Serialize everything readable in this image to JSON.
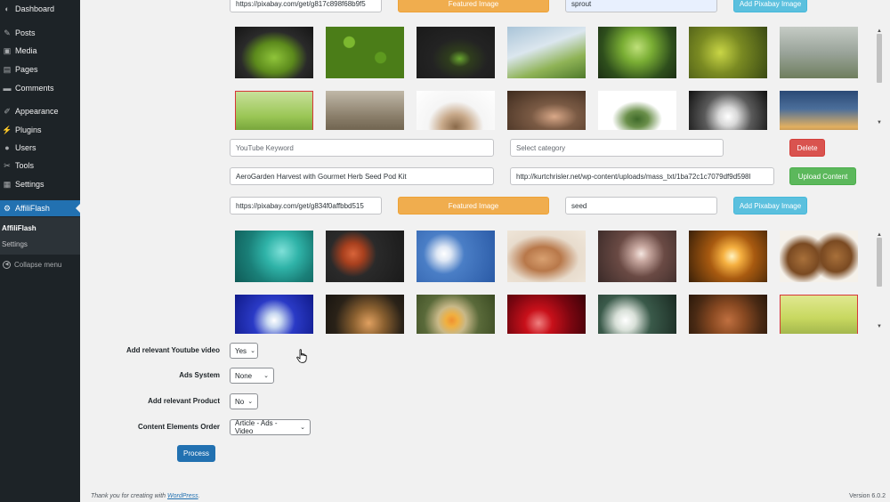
{
  "sidebar": {
    "items": [
      {
        "label": "Dashboard",
        "icon": "dashboard-icon",
        "glyph": "◐"
      },
      {
        "label": "Posts",
        "icon": "pin-icon",
        "glyph": "✎"
      },
      {
        "label": "Media",
        "icon": "media-icon",
        "glyph": "▣"
      },
      {
        "label": "Pages",
        "icon": "pages-icon",
        "glyph": "▤"
      },
      {
        "label": "Comments",
        "icon": "comments-icon",
        "glyph": "▬"
      },
      {
        "label": "Appearance",
        "icon": "brush-icon",
        "glyph": "✐"
      },
      {
        "label": "Plugins",
        "icon": "plug-icon",
        "glyph": "⚡"
      },
      {
        "label": "Users",
        "icon": "users-icon",
        "glyph": "●"
      },
      {
        "label": "Tools",
        "icon": "wrench-icon",
        "glyph": "✂"
      },
      {
        "label": "Settings",
        "icon": "settings-icon",
        "glyph": "▦"
      },
      {
        "label": "AffiliFlash",
        "icon": "gear-icon",
        "glyph": "⚙"
      }
    ],
    "submenu": {
      "title": "AffiliFlash",
      "settings": "Settings"
    },
    "collapse": "Collapse menu"
  },
  "block1": {
    "url_value": "https://pixabay.com/get/g817c898f68b9f5",
    "featured_label": "Featured Image",
    "keyword_value": "sprout",
    "add_pixabay_label": "Add Pixabay Image"
  },
  "block2": {
    "youtube_placeholder": "YouTube Keyword",
    "category_placeholder": "Select category",
    "delete_label": "Delete",
    "title_value": "AeroGarden Harvest with Gourmet Herb Seed Pod Kit",
    "file_url_value": "http://kurtchrisler.net/wp-content/uploads/mass_txt/1ba72c1c7079df9d598l",
    "upload_label": "Upload Content",
    "url_value": "https://pixabay.com/get/g834f0affbbd515",
    "featured_label": "Featured Image",
    "keyword_value": "seed",
    "add_pixabay_label": "Add Pixabay Image"
  },
  "form": {
    "youtube_label": "Add relevant Youtube video",
    "youtube_value": "Yes",
    "ads_label": "Ads System",
    "ads_value": "None",
    "product_label": "Add relevant Product",
    "product_value": "No",
    "order_label": "Content Elements Order",
    "order_value": "Article - Ads - Video",
    "process_label": "Process"
  },
  "footer": {
    "thanks_prefix": "Thank you for creating with ",
    "wp_link": "WordPress",
    "thanks_suffix": ".",
    "version": "Version 6.0.2"
  },
  "colors": {
    "sidebar_bg": "#1d2327",
    "active_blue": "#2271b1",
    "featured_orange": "#f0ad4e",
    "pixabay_blue": "#5bc0de",
    "delete_red": "#d9534f",
    "upload_green": "#5cb85c"
  }
}
